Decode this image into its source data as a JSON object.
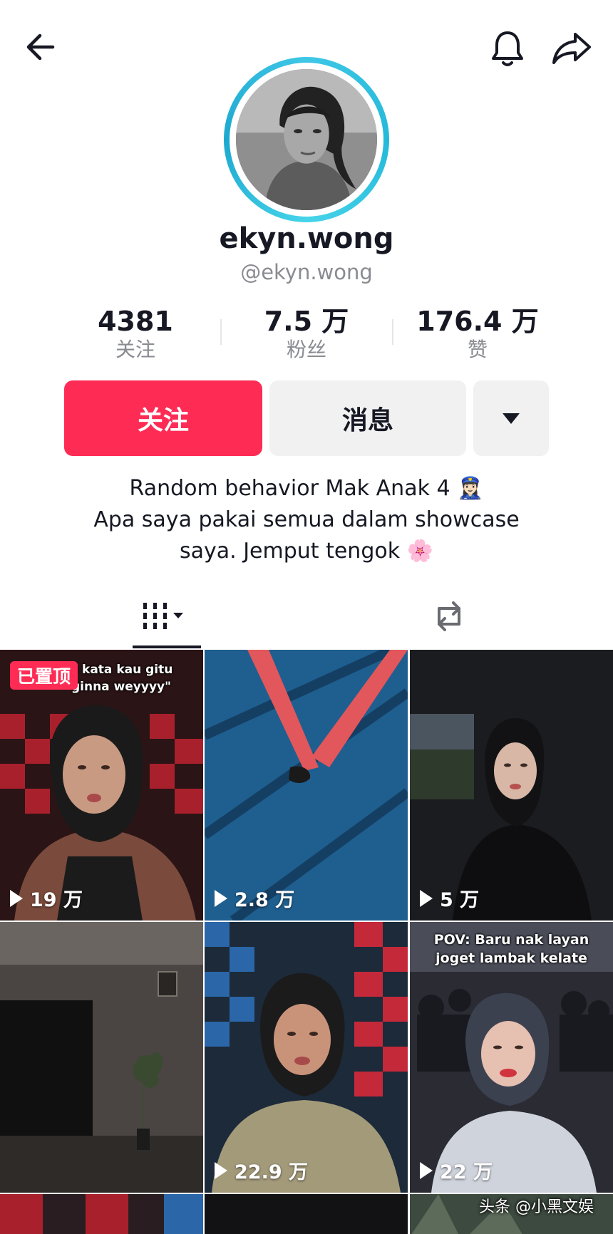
{
  "profile": {
    "display_name": "ekyn.wong",
    "handle": "@ekyn.wong",
    "bio_line1": "Random behavior Mak Anak 4 👮🏻‍♀️",
    "bio_line2": "Apa saya pakai semua dalam showcase",
    "bio_line3": "saya. Jemput tengok 🌸"
  },
  "stats": [
    {
      "value": "4381",
      "label": "关注"
    },
    {
      "value": "7.5 万",
      "label": "粉丝"
    },
    {
      "value": "176.4 万",
      "label": "赞"
    }
  ],
  "actions": {
    "follow_label": "关注",
    "message_label": "消息"
  },
  "icons": {
    "back": "arrow-left-icon",
    "bell": "bell-icon",
    "share": "share-arrow-icon",
    "videos_tab": "grid-bars-icon",
    "reposts_tab": "repost-icon",
    "dropdown": "caret-down-icon"
  },
  "colors": {
    "accent": "#fe2c55",
    "ring": "#25b9d9",
    "secondary_button": "#f1f1f2",
    "muted_text": "#8a8b91"
  },
  "videos": [
    {
      "views": "19 万",
      "pinned_label": "已置顶",
      "caption": "a kata kau gitu\nginna weyyyy\""
    },
    {
      "views": "2.8 万"
    },
    {
      "views": "5 万"
    },
    {
      "views": ""
    },
    {
      "views": "22.9 万"
    },
    {
      "views": "22 万",
      "caption": "POV: Baru nak layan\njoget lambak kelate"
    }
  ],
  "watermark": "头条 @小黑文娱"
}
